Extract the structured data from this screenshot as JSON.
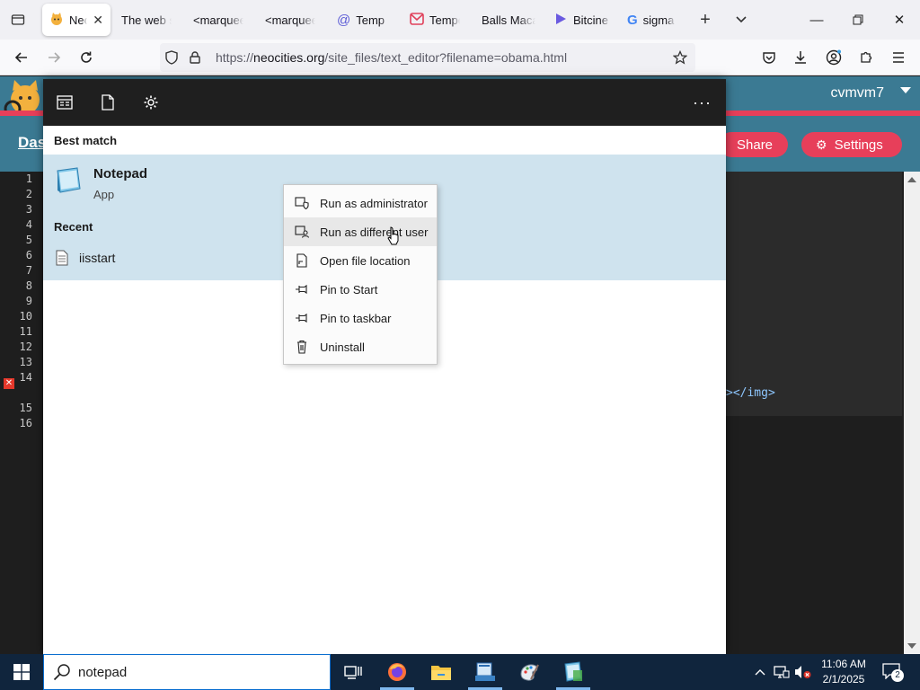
{
  "browser": {
    "tabs": [
      {
        "title": "Neo",
        "active": true
      },
      {
        "title": "The web sit"
      },
      {
        "title": "<marquee"
      },
      {
        "title": "<marquee"
      },
      {
        "title": "Temp"
      },
      {
        "title": "Tempo"
      },
      {
        "title": "Balls Maca"
      },
      {
        "title": "Bitcine"
      },
      {
        "title": "sigma"
      }
    ],
    "url": {
      "prefix": "https://",
      "host": "neocities.org",
      "path": "/site_files/text_editor?filename=obama.html"
    }
  },
  "site": {
    "username": "cvmvm7",
    "dashboard_label": "Das",
    "share_label": "Share",
    "settings_label": "Settings",
    "code_snippet": "></img>",
    "line_numbers": [
      "1",
      "2",
      "3",
      "4",
      "5",
      "6",
      "7",
      "8",
      "9",
      "10",
      "11",
      "12",
      "13",
      "14",
      "",
      "15",
      "16"
    ]
  },
  "start_menu": {
    "best_match_header": "Best match",
    "best_match": {
      "name": "Notepad",
      "type": "App"
    },
    "recent_header": "Recent",
    "recent_items": [
      {
        "name": "iisstart"
      }
    ],
    "more_label": "···"
  },
  "context_menu": {
    "items": [
      {
        "label": "Run as administrator",
        "icon": "shield-icon"
      },
      {
        "label": "Run as different user",
        "icon": "user-icon",
        "hover": true
      },
      {
        "label": "Open file location",
        "icon": "folder-location-icon"
      },
      {
        "label": "Pin to Start",
        "icon": "pin-icon"
      },
      {
        "label": "Pin to taskbar",
        "icon": "pin-icon"
      },
      {
        "label": "Uninstall",
        "icon": "trash-icon"
      }
    ]
  },
  "taskbar": {
    "search_value": "notepad",
    "time": "11:06 AM",
    "date": "2/1/2025",
    "notification_count": "2"
  },
  "colors": {
    "site_header": "#3b7a93",
    "site_accent": "#e73f5a",
    "taskbar": "#10253d",
    "result_highlight": "#cfe3ee"
  }
}
